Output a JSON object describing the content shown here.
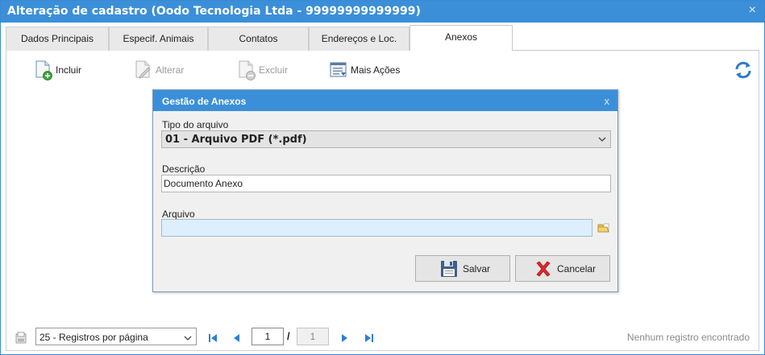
{
  "window": {
    "title": "Alteração de cadastro (Oodo Tecnologia Ltda - 99999999999999)",
    "close_glyph": "×"
  },
  "tabs": [
    {
      "label": "Dados Principais",
      "active": false
    },
    {
      "label": "Especif. Animais",
      "active": false
    },
    {
      "label": "Contatos",
      "active": false
    },
    {
      "label": "Endereços e Loc.",
      "active": false
    },
    {
      "label": "Anexos",
      "active": true
    }
  ],
  "toolbar": {
    "incluir": {
      "label": "Incluir",
      "icon": "document-add-icon",
      "enabled": true
    },
    "alterar": {
      "label": "Alterar",
      "icon": "document-edit-icon",
      "enabled": false
    },
    "excluir": {
      "label": "Excluir",
      "icon": "document-remove-icon",
      "enabled": false
    },
    "mais_acoes": {
      "label": "Mais Ações",
      "icon": "list-actions-icon",
      "enabled": true
    },
    "refresh_icon": "refresh-icon"
  },
  "dialog": {
    "title": "Gestão de Anexos",
    "close_glyph": "x",
    "tipo_label": "Tipo do arquivo",
    "tipo_value": "01 - Arquivo PDF (*.pdf)",
    "descricao_label": "Descrição",
    "descricao_value": "Documento Anexo",
    "arquivo_label": "Arquivo",
    "arquivo_value": "",
    "salvar_label": "Salvar",
    "cancelar_label": "Cancelar"
  },
  "pager": {
    "per_page": "25 - Registros por página",
    "current_page": "1",
    "separator": "/",
    "total_pages": "1",
    "status": "Nenhum registro encontrado"
  },
  "colors": {
    "titlebar": "#3b8fd9",
    "file_input": "#ddeffd",
    "pager_icon": "#2f7fd1"
  }
}
